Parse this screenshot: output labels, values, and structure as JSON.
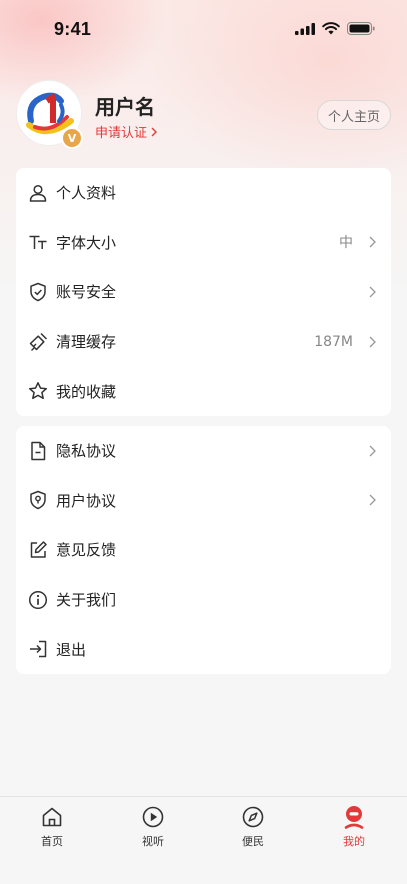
{
  "status_bar": {
    "time": "9:41"
  },
  "profile": {
    "username": "用户名",
    "verify_label": "申请认证",
    "home_button": "个人主页",
    "badge_letter": "V"
  },
  "menu_group_1": [
    {
      "label": "个人资料",
      "value": "",
      "icon": "user-icon",
      "chevron": false
    },
    {
      "label": "字体大小",
      "value": "中",
      "icon": "font-size-icon",
      "chevron": true
    },
    {
      "label": "账号安全",
      "value": "",
      "icon": "shield-icon",
      "chevron": true
    },
    {
      "label": "清理缓存",
      "value": "187M",
      "icon": "broom-icon",
      "chevron": true
    },
    {
      "label": "我的收藏",
      "value": "",
      "icon": "star-icon",
      "chevron": false
    }
  ],
  "menu_group_2": [
    {
      "label": "隐私协议",
      "value": "",
      "icon": "document-icon",
      "chevron": true
    },
    {
      "label": "用户协议",
      "value": "",
      "icon": "shield-location-icon",
      "chevron": true
    },
    {
      "label": "意见反馈",
      "value": "",
      "icon": "edit-icon",
      "chevron": false
    },
    {
      "label": "关于我们",
      "value": "",
      "icon": "info-icon",
      "chevron": false
    },
    {
      "label": "退出",
      "value": "",
      "icon": "logout-icon",
      "chevron": false
    }
  ],
  "tabbar": [
    {
      "label": "首页",
      "icon": "home-icon",
      "active": false
    },
    {
      "label": "视听",
      "icon": "play-icon",
      "active": false
    },
    {
      "label": "便民",
      "icon": "compass-icon",
      "active": false
    },
    {
      "label": "我的",
      "icon": "profile-icon",
      "active": true
    }
  ],
  "colors": {
    "accent": "#e23a3a",
    "badge": "#e8a64a",
    "background": "#f6f6f6"
  }
}
